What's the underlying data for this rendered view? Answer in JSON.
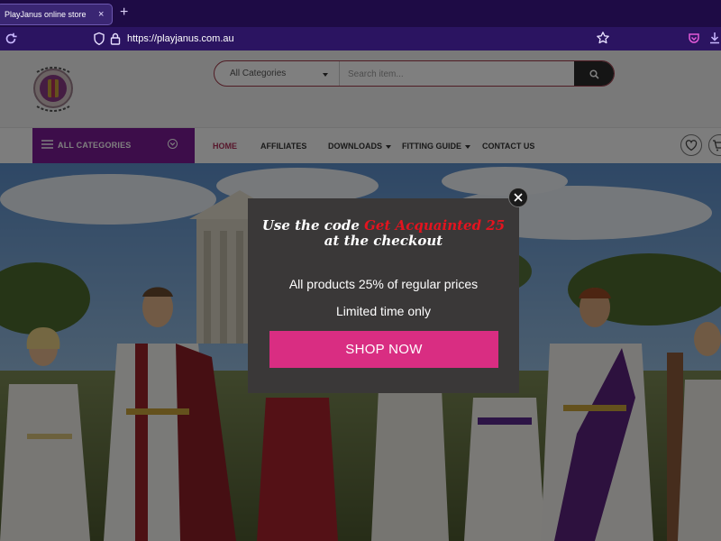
{
  "browser": {
    "tab_title": "PlayJanus online store",
    "tab_close": "×",
    "new_tab": "+",
    "url": "https://playjanus.com.au"
  },
  "site": {
    "search": {
      "category": "All Categories",
      "placeholder": "Search item..."
    },
    "all_categories": "ALL CATEGORIES",
    "nav": {
      "home": "HOME",
      "affiliates": "AFFILIATES",
      "downloads": "DOWNLOADS",
      "fitting_guide": "FITTING GUIDE",
      "contact_us": "CONTACT US"
    }
  },
  "popup": {
    "promo_prefix": "Use the code ",
    "promo_code": "Get Acquainted 25",
    "promo_suffix": " at the checkout",
    "line1": "All products 25% of regular prices",
    "line2": "Limited time only",
    "cta": "SHOP NOW"
  },
  "colors": {
    "tabbar": "#1e0b45",
    "urlbar": "#2b1461",
    "category_button": "#7a1a94",
    "cta": "#d92d82",
    "promo_code": "#e3141f",
    "popup_bg": "#3a3838"
  }
}
